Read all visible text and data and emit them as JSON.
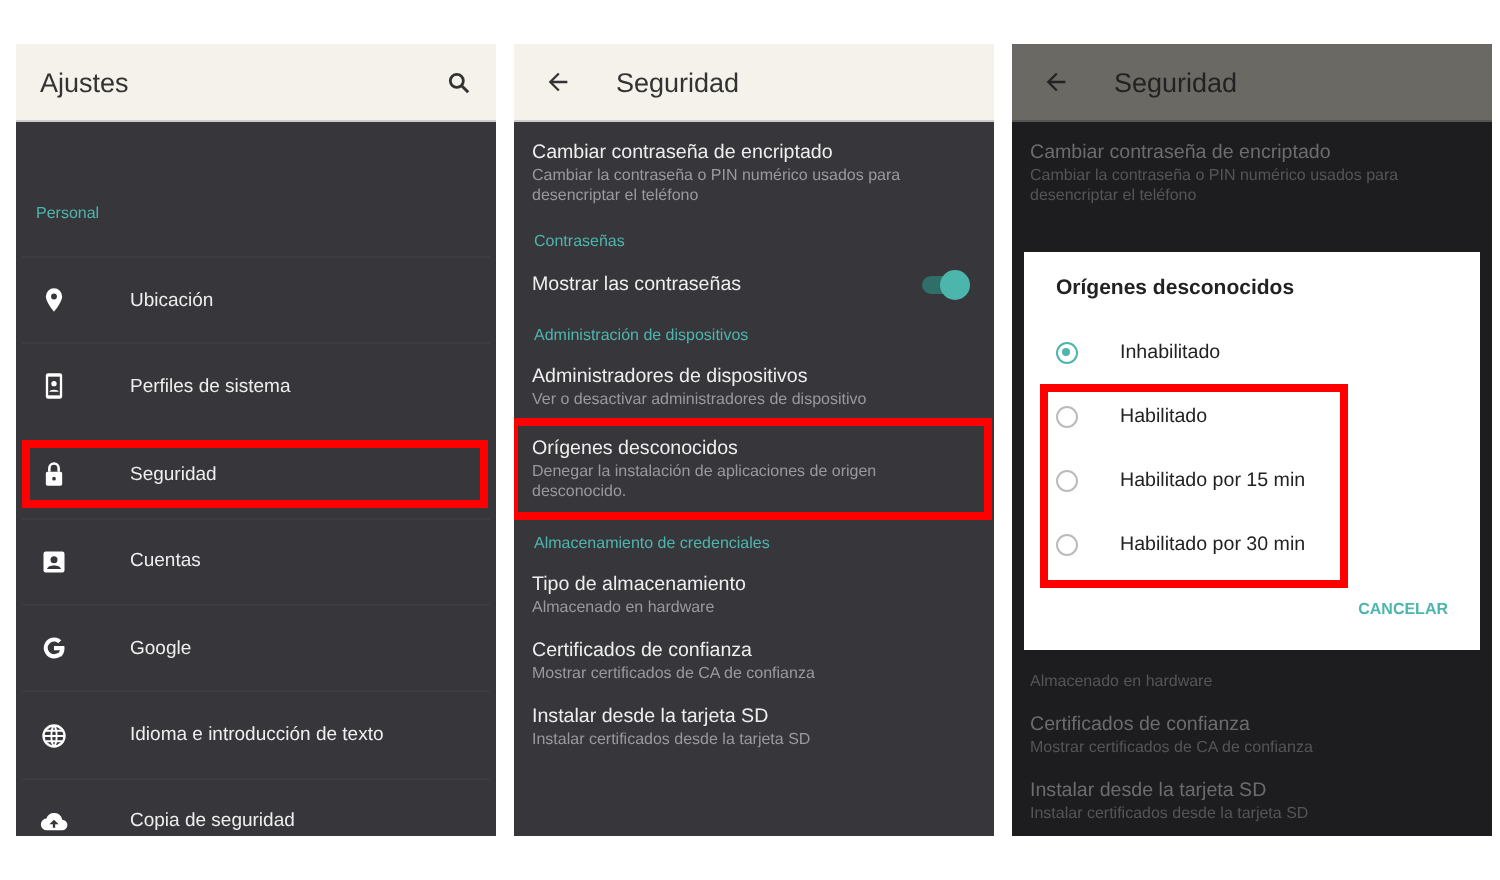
{
  "screens": [
    {
      "header": {
        "title": "Ajustes",
        "back": false,
        "search": true
      },
      "dimmed": false,
      "rows": [
        {
          "kind": "section",
          "text": "Personal"
        },
        {
          "kind": "icon-item",
          "title": "Ubicación",
          "highlighted": false
        },
        {
          "kind": "icon-item",
          "title": "Perfiles de sistema",
          "highlighted": false
        },
        {
          "kind": "icon-item",
          "title": "Seguridad",
          "highlighted": true
        },
        {
          "kind": "icon-item",
          "title": "Cuentas",
          "highlighted": false
        },
        {
          "kind": "icon-item",
          "title": "Google",
          "highlighted": false
        },
        {
          "kind": "icon-item",
          "title": "Idioma e introducción de texto",
          "highlighted": false
        },
        {
          "kind": "icon-item",
          "title": "Copia de seguridad",
          "highlighted": false
        }
      ]
    },
    {
      "header": {
        "title": "Seguridad",
        "back": true,
        "search": false
      },
      "dimmed": false,
      "rows": [
        {
          "kind": "item",
          "title": "Cambiar contraseña de encriptado",
          "subtitle": "Cambiar la contraseña o PIN numérico usados para desencriptar el teléfono",
          "highlighted": false
        },
        {
          "kind": "section",
          "text": "Contraseñas"
        },
        {
          "kind": "toggle",
          "title": "Mostrar las contraseñas",
          "on": true
        },
        {
          "kind": "section",
          "text": "Administración de dispositivos"
        },
        {
          "kind": "item",
          "title": "Administradores de dispositivos",
          "subtitle": "Ver o desactivar administradores de dispositivo",
          "highlighted": false
        },
        {
          "kind": "item",
          "title": "Orígenes desconocidos",
          "subtitle": "Denegar la instalación de aplicaciones de origen desconocido.",
          "highlighted": true
        },
        {
          "kind": "section",
          "text": "Almacenamiento de credenciales"
        },
        {
          "kind": "item",
          "title": "Tipo de almacenamiento",
          "subtitle": "Almacenado en hardware",
          "highlighted": false
        },
        {
          "kind": "item",
          "title": "Certificados de confianza",
          "subtitle": "Mostrar certificados de CA de confianza",
          "highlighted": false
        },
        {
          "kind": "item",
          "title": "Instalar desde la tarjeta SD",
          "subtitle": "Instalar certificados desde la tarjeta SD",
          "highlighted": false
        }
      ]
    },
    {
      "header": {
        "title": "Seguridad",
        "back": true,
        "search": false
      },
      "dimmed": true,
      "rows": [
        {
          "kind": "item",
          "title": "Cambiar contraseña de encriptado",
          "subtitle": "Cambiar la contraseña o PIN numérico usados para desencriptar el teléfono",
          "highlighted": false
        },
        {
          "kind": "dialog",
          "title": "Orígenes desconocidos",
          "options": [
            {
              "label": "Inhabilitado",
              "selected": true,
              "highlighted": false
            },
            {
              "label": "Habilitado",
              "selected": false,
              "highlighted": true
            },
            {
              "label": "Habilitado por 15 min",
              "selected": false,
              "highlighted": true
            },
            {
              "label": "Habilitado por 30 min",
              "selected": false,
              "highlighted": true
            }
          ],
          "button": "CANCELAR"
        },
        {
          "kind": "item",
          "subtitle": "Almacenado en hardware",
          "highlighted": false
        },
        {
          "kind": "item",
          "title": "Certificados de confianza",
          "subtitle": "Mostrar certificados de CA de confianza",
          "highlighted": false
        },
        {
          "kind": "item",
          "title": "Instalar desde la tarjeta SD",
          "subtitle": "Instalar certificados desde la tarjeta SD",
          "highlighted": false
        }
      ]
    }
  ]
}
